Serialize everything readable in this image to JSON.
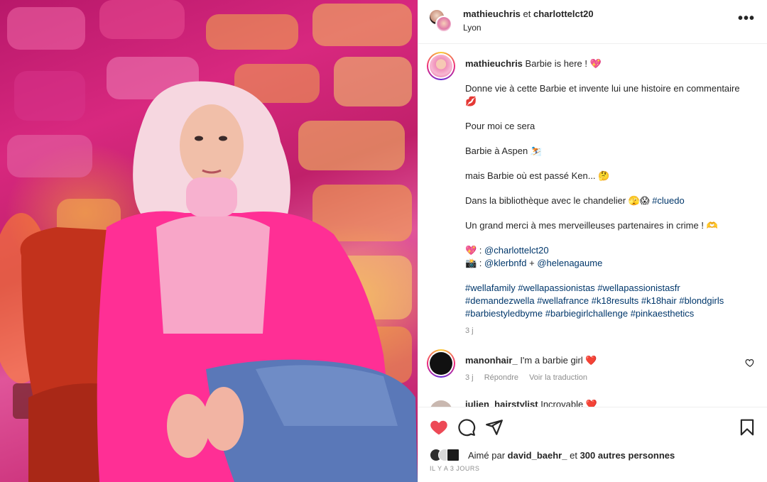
{
  "post": {
    "header": {
      "user1": "mathieuchris",
      "connector": "et",
      "user2": "charlottelct20",
      "location": "Lyon",
      "more_icon": "more-dots-icon"
    },
    "caption": {
      "username": "mathieuchris",
      "line1": "Barbie is here ! 💖",
      "para1": "Donne vie à cette Barbie et invente lui une histoire en commentaire 💋",
      "para2": "Pour moi ce sera",
      "para3": "Barbie à Aspen ⛷️",
      "para4": "mais Barbie où est passé Ken... 🤔",
      "para5_text": "Dans la bibliothèque avec le chandelier 🫣😱",
      "para5_tag": "#cluedo",
      "para6": "Un grand merci à mes merveilleuses partenaires in crime ! 🫶",
      "credit1_prefix": "💖 : ",
      "credit1_tag": "@charlottelct20",
      "credit2_prefix": "📸 : ",
      "credit2_tag1": "@klerbnfd",
      "credit2_plus": " + ",
      "credit2_tag2": "@helenagaume",
      "hashtags": "#wellafamily #wellapassionistas #wellapassionistasfr #demandezwella #wellafrance #k18results #k18hair #blondgirls #barbiestyledbyme #barbiegirlchallenge #pinkaesthetics",
      "time": "3 j"
    },
    "comments": [
      {
        "username": "manonhair_",
        "text": "I'm a barbie girl ❤️",
        "time": "3 j",
        "reply": "Répondre",
        "translate": "Voir la traduction"
      },
      {
        "username": "julien_hairstylist",
        "text": "Incroyable ❤️"
      }
    ],
    "likes": {
      "prefix": "Aimé par",
      "user": "david_baehr_",
      "connector": "et",
      "others": "300 autres personnes"
    },
    "date": "IL Y A 3 JOURS",
    "colors": {
      "like": "#ed4956",
      "link": "#00376b",
      "muted": "#8e8e8e"
    }
  }
}
